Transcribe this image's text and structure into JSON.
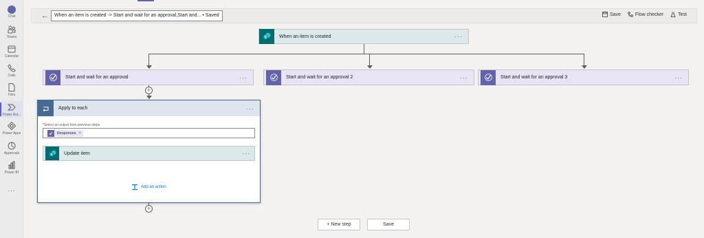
{
  "rail": {
    "items": [
      {
        "label": "Chat",
        "icon": "chat-icon"
      },
      {
        "label": "Teams",
        "icon": "teams-icon"
      },
      {
        "label": "Calendar",
        "icon": "calendar-icon"
      },
      {
        "label": "Calls",
        "icon": "calls-icon"
      },
      {
        "label": "Files",
        "icon": "files-icon"
      },
      {
        "label": "Power Aut...",
        "icon": "power-automate-icon",
        "active": true
      },
      {
        "label": "Power Apps",
        "icon": "power-apps-icon"
      },
      {
        "label": "Approvals",
        "icon": "approvals-icon"
      },
      {
        "label": "Power BI",
        "icon": "power-bi-icon"
      }
    ],
    "more": "..."
  },
  "toolbar": {
    "breadcrumb": "When an item is created -> Start and wait for an approval,Start and... • Saved",
    "save_label": "Save",
    "flow_checker_label": "Flow checker",
    "test_label": "Test"
  },
  "flow": {
    "trigger": {
      "title": "When an item is created",
      "icon": "sharepoint-icon"
    },
    "approvals": [
      {
        "title": "Start and wait for an approval",
        "icon": "approval-icon"
      },
      {
        "title": "Start and wait for an approval 2",
        "icon": "approval-icon"
      },
      {
        "title": "Start and wait for an approval 3",
        "icon": "approval-icon"
      }
    ],
    "apply_to_each": {
      "title": "Apply to each",
      "field_label": "Select an output from previous steps",
      "token": "Responses",
      "inner_action": "Update item",
      "add_action": "Add an action"
    },
    "more_menu": "···"
  },
  "footer": {
    "new_step_label": "+ New step",
    "save_label": "Save"
  },
  "colors": {
    "approval": "#6264a7",
    "sharepoint": "#036c70",
    "loop": "#486991",
    "link": "#0078d4"
  }
}
